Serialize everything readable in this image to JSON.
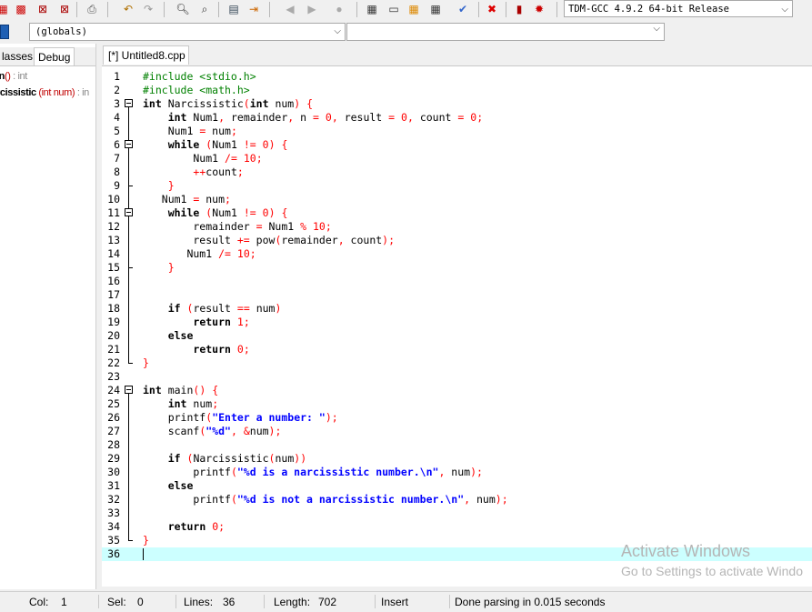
{
  "toolbar": {
    "compiler": "TDM-GCC 4.9.2 64-bit Release",
    "icons": [
      "new-file-icon",
      "open-file-icon",
      "save-icon",
      "save-all-icon",
      "close-icon",
      "print-icon",
      "undo-icon",
      "redo-icon",
      "find-icon",
      "replace-icon",
      "goto-icon",
      "indent-icon",
      "unindent-icon",
      "back-icon",
      "forward-icon",
      "toggle-bookmark-icon",
      "compile-icon",
      "run-icon",
      "compile-run-icon",
      "rebuild-icon",
      "check-icon",
      "stop-icon",
      "chart-icon",
      "profile-delete-icon"
    ]
  },
  "scope_bar": {
    "scope": "(globals)",
    "member": ""
  },
  "left_panel": {
    "tabs": [
      "lasses",
      "Debug"
    ],
    "items": [
      {
        "name": "in",
        "sig": "()",
        "type": " : int"
      },
      {
        "name": "rcissistic",
        "sig": " (int num)",
        "type": " : in"
      }
    ]
  },
  "editor": {
    "tab_title": "[*] Untitled8.cpp",
    "lines": [
      "#include <stdio.h>",
      "#include <math.h>",
      "int Narcissistic(int num) {",
      "    int Num1, remainder, n = 0, result = 0, count = 0;",
      "    Num1 = num;",
      "    while (Num1 != 0) {",
      "        Num1 /= 10;",
      "        ++count;",
      "    }",
      "   Num1 = num;",
      "    while (Num1 != 0) {",
      "        remainder = Num1 % 10;",
      "        result += pow(remainder, count);",
      "       Num1 /= 10;",
      "    }",
      "",
      "",
      "    if (result == num)",
      "        return 1;",
      "    else",
      "        return 0;",
      "}",
      "",
      "int main() {",
      "    int num;",
      "    printf(\"Enter a number: \");",
      "    scanf(\"%d\", &num);",
      "",
      "    if (Narcissistic(num))",
      "        printf(\"%d is a narcissistic number.\\n\", num);",
      "    else",
      "        printf(\"%d is not a narcissistic number.\\n\", num);",
      "",
      "    return 0;",
      "}",
      ""
    ],
    "active_line": 36
  },
  "watermark": {
    "title": "Activate Windows",
    "subtitle": "Go to Settings to activate Windo"
  },
  "status": {
    "col_label": "Col:",
    "col": "1",
    "sel_label": "Sel:",
    "sel": "0",
    "lines_label": "Lines:",
    "lines": "36",
    "length_label": "Length:",
    "length": "702",
    "mode": "Insert",
    "message": "Done parsing in 0.015 seconds"
  }
}
